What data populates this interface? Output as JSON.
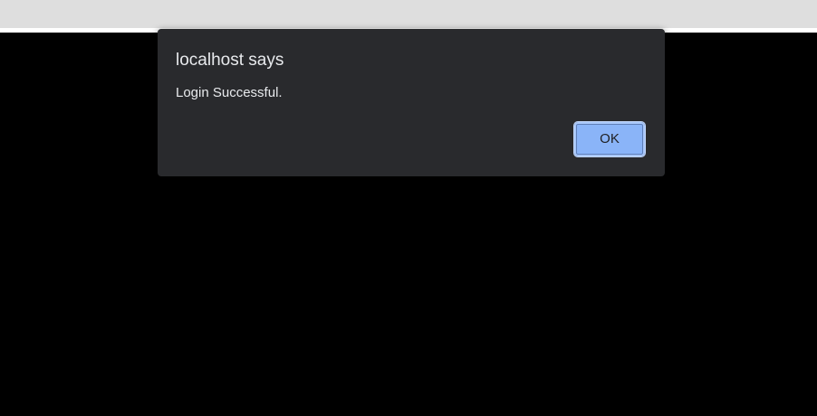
{
  "alert": {
    "title": "localhost says",
    "message": "Login Successful.",
    "ok_label": "OK"
  },
  "colors": {
    "chrome": "#dedede",
    "page_background": "#000000",
    "dialog_background": "#292a2d",
    "button_background": "#8ab4f8",
    "text": "#e8eaed"
  }
}
